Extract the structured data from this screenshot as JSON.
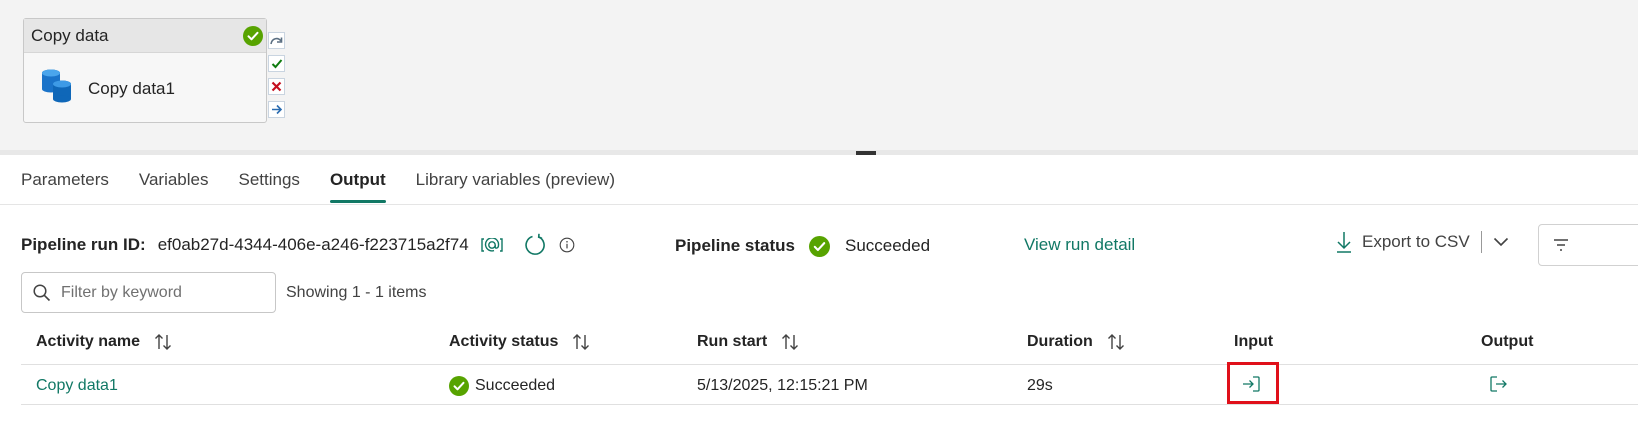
{
  "canvas": {
    "activity": {
      "type_label": "Copy data",
      "name": "Copy data1",
      "status_icon": "check-circle-icon"
    },
    "handles": [
      "skip-arrow-icon",
      "success-check-icon",
      "failure-x-icon",
      "completion-arrow-icon"
    ]
  },
  "tabs": [
    {
      "label": "Parameters",
      "active": false
    },
    {
      "label": "Variables",
      "active": false
    },
    {
      "label": "Settings",
      "active": false
    },
    {
      "label": "Output",
      "active": true
    },
    {
      "label": "Library variables (preview)",
      "active": false
    }
  ],
  "run_info": {
    "run_id_label": "Pipeline run ID:",
    "run_id": "ef0ab27d-4344-406e-a246-f223715a2f74",
    "status_label": "Pipeline status",
    "status": "Succeeded",
    "view_run_detail": "View run detail",
    "export_label": "Export to CSV"
  },
  "filter": {
    "placeholder": "Filter by keyword",
    "value": "",
    "showing": "Showing 1 - 1 items"
  },
  "table": {
    "columns": [
      "Activity name",
      "Activity status",
      "Run start",
      "Duration",
      "Input",
      "Output"
    ],
    "rows": [
      {
        "activity_name": "Copy data1",
        "activity_status": "Succeeded",
        "run_start": "5/13/2025, 12:15:21 PM",
        "duration": "29s"
      }
    ]
  },
  "colors": {
    "accent": "#117865",
    "success": "#57a300",
    "failure": "#c50f1f",
    "highlight": "#e0101a"
  }
}
